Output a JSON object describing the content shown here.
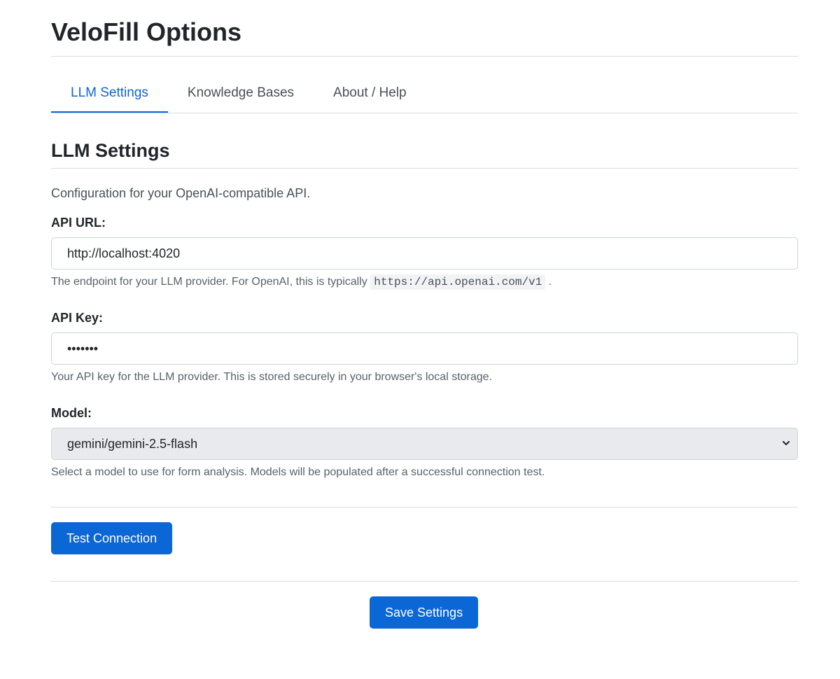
{
  "app": {
    "title": "VeloFill Options"
  },
  "tabs": [
    {
      "label": "LLM Settings",
      "active": true
    },
    {
      "label": "Knowledge Bases",
      "active": false
    },
    {
      "label": "About / Help",
      "active": false
    }
  ],
  "section": {
    "title": "LLM Settings",
    "description": "Configuration for your OpenAI-compatible API."
  },
  "api_url": {
    "label": "API URL:",
    "value": "http://localhost:4020",
    "help_prefix": "The endpoint for your LLM provider. For OpenAI, this is typically",
    "help_code": "https://api.openai.com/v1",
    "help_suffix": "."
  },
  "api_key": {
    "label": "API Key:",
    "value": "1234567",
    "help": "Your API key for the LLM provider. This is stored securely in your browser's local storage."
  },
  "model": {
    "label": "Model:",
    "selected": "gemini/gemini-2.5-flash",
    "help": "Select a model to use for form analysis. Models will be populated after a successful connection test."
  },
  "buttons": {
    "test_connection": "Test Connection",
    "save_settings": "Save Settings"
  },
  "colors": {
    "accent": "#0b66d6",
    "select_bg": "#e9eaee",
    "divider": "#d9dce0"
  },
  "icons": {
    "select_chevron": "chevron-down-icon"
  }
}
